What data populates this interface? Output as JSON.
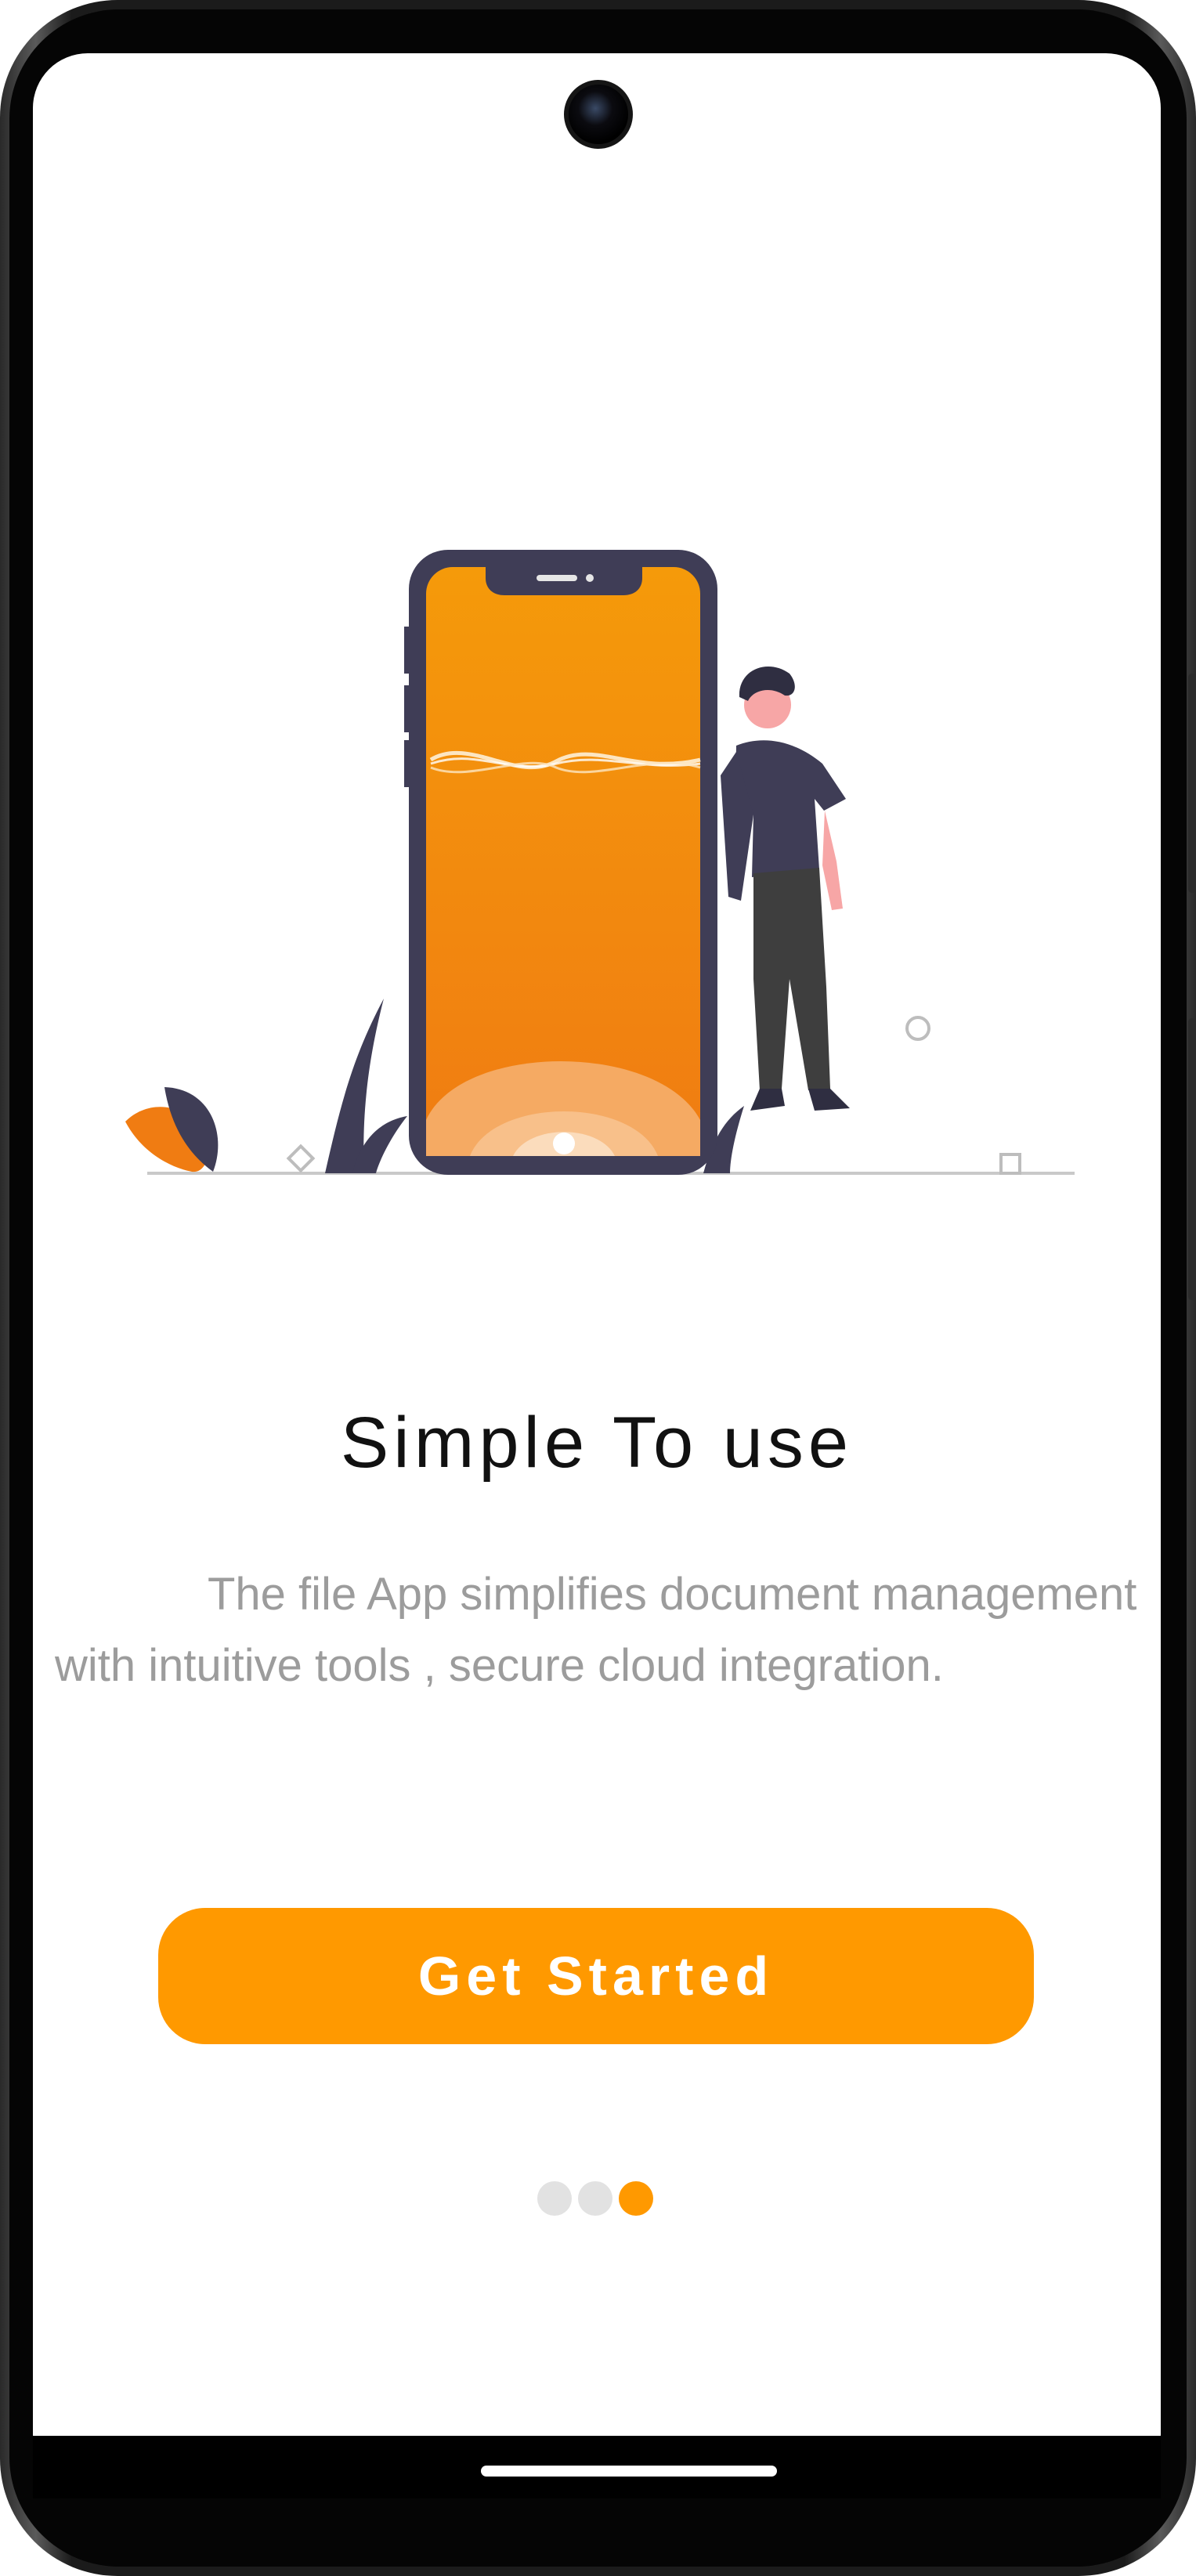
{
  "onboarding": {
    "title": "Simple To use",
    "description": "The file App simplifies document management with intuitive tools , secure cloud integration.",
    "cta_label": "Get Started",
    "page_indicator": {
      "total": 3,
      "current": 3
    }
  },
  "colors": {
    "accent": "#ff9900",
    "title_text": "#111111",
    "body_text": "#9c9c9c",
    "dot_inactive": "#e2e2e2",
    "illustration_dark": "#3f3d56"
  },
  "icons": {
    "illustration": "person-leaning-on-phone-illustration",
    "camera": "front-camera"
  }
}
